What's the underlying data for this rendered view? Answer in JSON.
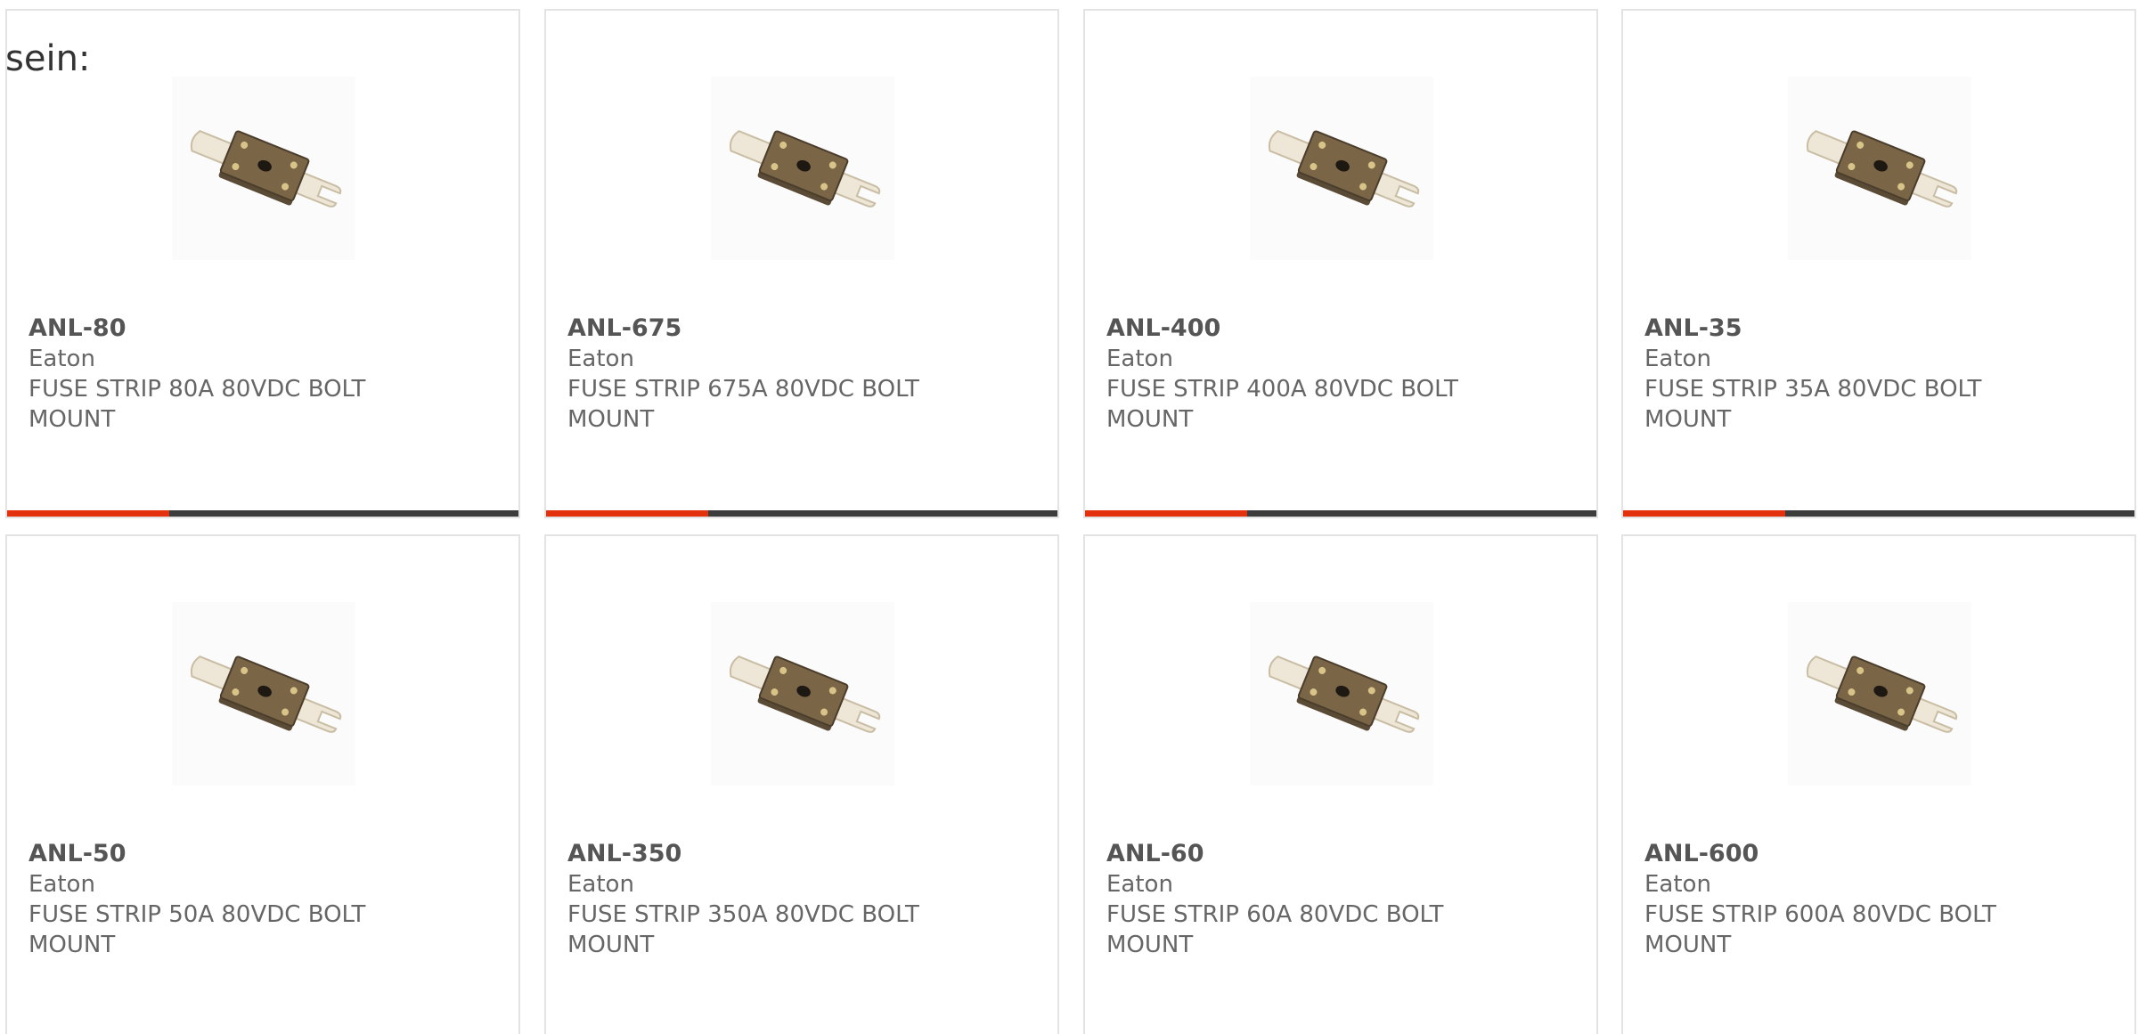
{
  "intro_text": "sein:",
  "colors": {
    "accent": "#e3310e",
    "bar": "#3c3c3c",
    "card_border": "#e3e3e3",
    "text": "#666666"
  },
  "products": [
    {
      "part": "ANL-80",
      "brand": "Eaton",
      "desc_line1": "FUSE STRIP 80A 80VDC BOLT",
      "desc_line2": "MOUNT",
      "image": "anl-fuse-image"
    },
    {
      "part": "ANL-675",
      "brand": "Eaton",
      "desc_line1": "FUSE STRIP 675A 80VDC BOLT",
      "desc_line2": "MOUNT",
      "image": "anl-fuse-image"
    },
    {
      "part": "ANL-400",
      "brand": "Eaton",
      "desc_line1": "FUSE STRIP 400A 80VDC BOLT",
      "desc_line2": "MOUNT",
      "image": "anl-fuse-image"
    },
    {
      "part": "ANL-35",
      "brand": "Eaton",
      "desc_line1": "FUSE STRIP 35A 80VDC BOLT",
      "desc_line2": "MOUNT",
      "image": "anl-fuse-image"
    },
    {
      "part": "ANL-50",
      "brand": "Eaton",
      "desc_line1": "FUSE STRIP 50A 80VDC BOLT",
      "desc_line2": "MOUNT",
      "image": "anl-fuse-image"
    },
    {
      "part": "ANL-350",
      "brand": "Eaton",
      "desc_line1": "FUSE STRIP 350A 80VDC BOLT",
      "desc_line2": "MOUNT",
      "image": "anl-fuse-image"
    },
    {
      "part": "ANL-60",
      "brand": "Eaton",
      "desc_line1": "FUSE STRIP 60A 80VDC BOLT",
      "desc_line2": "MOUNT",
      "image": "anl-fuse-image"
    },
    {
      "part": "ANL-600",
      "brand": "Eaton",
      "desc_line1": "FUSE STRIP 600A 80VDC BOLT",
      "desc_line2": "MOUNT",
      "image": "anl-fuse-image"
    }
  ]
}
